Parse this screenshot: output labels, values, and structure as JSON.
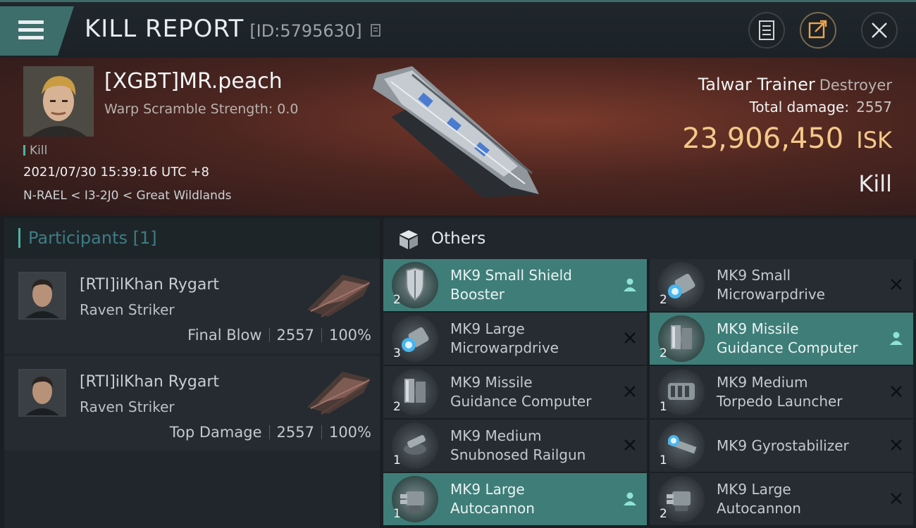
{
  "header": {
    "title": "KILL REPORT",
    "report_id": "[ID:5795630]"
  },
  "victim": {
    "name": "[XGBT]MR.peach",
    "warp_scramble": "Warp Scramble Strength: 0.0",
    "tag": "Kill",
    "datetime": "2021/07/30 15:39:16 UTC +8",
    "location": "N-RAEL < I3-2J0 < Great Wildlands",
    "ship_name": "Talwar Trainer",
    "ship_class": "Destroyer",
    "total_damage_label": "Total damage:",
    "total_damage": "2557",
    "isk_value": "23,906,450",
    "isk_unit": "ISK",
    "result": "Kill"
  },
  "participants": {
    "title": "Participants [1]",
    "items": [
      {
        "name": "[RTI]ilKhan Rygart",
        "ship": "Raven Striker",
        "label": "Final Blow",
        "damage": "2557",
        "percent": "100%"
      },
      {
        "name": "[RTI]ilKhan Rygart",
        "ship": "Raven Striker",
        "label": "Top Damage",
        "damage": "2557",
        "percent": "100%"
      }
    ]
  },
  "others": {
    "title": "Others",
    "items": [
      {
        "line1": "MK9 Small Shield",
        "line2": "Booster",
        "qty": "2",
        "icon": "shield-icon",
        "highlighted": true
      },
      {
        "line1": "MK9 Small",
        "line2": "Microwarpdrive",
        "qty": "2",
        "icon": "microwarpdrive-icon",
        "highlighted": false
      },
      {
        "line1": "MK9 Large",
        "line2": "Microwarpdrive",
        "qty": "3",
        "icon": "microwarpdrive-icon",
        "highlighted": false
      },
      {
        "line1": "MK9 Missile",
        "line2": "Guidance Computer",
        "qty": "2",
        "icon": "guidance-computer-icon",
        "highlighted": true
      },
      {
        "line1": "MK9 Missile",
        "line2": "Guidance Computer",
        "qty": "2",
        "icon": "guidance-computer-icon",
        "highlighted": false
      },
      {
        "line1": "MK9 Medium",
        "line2": "Torpedo Launcher",
        "qty": "1",
        "icon": "torpedo-launcher-icon",
        "highlighted": false
      },
      {
        "line1": "MK9 Medium",
        "line2": "Snubnosed Railgun",
        "qty": "1",
        "icon": "railgun-icon",
        "highlighted": false
      },
      {
        "line1": "MK9 Gyrostabilizer",
        "line2": "",
        "qty": "1",
        "icon": "gyrostabilizer-icon",
        "highlighted": false
      },
      {
        "line1": "MK9 Large",
        "line2": "Autocannon",
        "qty": "1",
        "icon": "autocannon-icon",
        "highlighted": true
      },
      {
        "line1": "MK9 Large",
        "line2": "Autocannon",
        "qty": "2",
        "icon": "autocannon-icon",
        "highlighted": false
      }
    ]
  },
  "colors": {
    "accent": "#3f7d78",
    "isk": "#f4c889",
    "tag": "#4fb3a4"
  }
}
